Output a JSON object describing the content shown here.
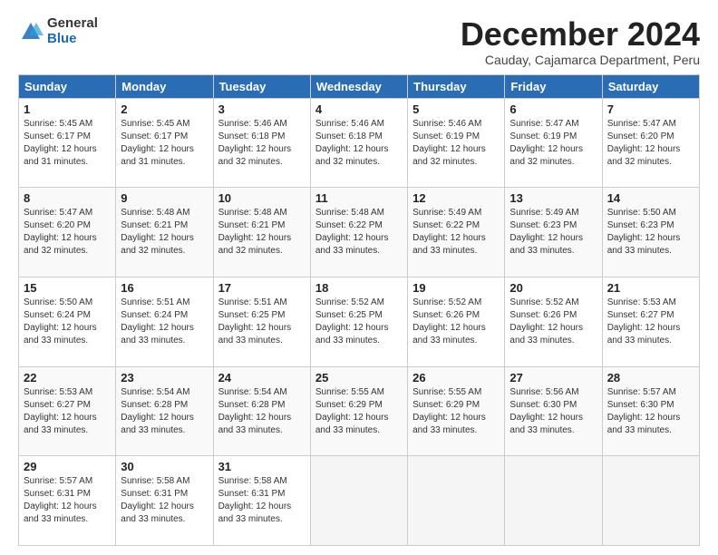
{
  "logo": {
    "general": "General",
    "blue": "Blue"
  },
  "title": "December 2024",
  "subtitle": "Cauday, Cajamarca Department, Peru",
  "headers": [
    "Sunday",
    "Monday",
    "Tuesday",
    "Wednesday",
    "Thursday",
    "Friday",
    "Saturday"
  ],
  "weeks": [
    [
      {
        "day": "1",
        "info": "Sunrise: 5:45 AM\nSunset: 6:17 PM\nDaylight: 12 hours\nand 31 minutes."
      },
      {
        "day": "2",
        "info": "Sunrise: 5:45 AM\nSunset: 6:17 PM\nDaylight: 12 hours\nand 31 minutes."
      },
      {
        "day": "3",
        "info": "Sunrise: 5:46 AM\nSunset: 6:18 PM\nDaylight: 12 hours\nand 32 minutes."
      },
      {
        "day": "4",
        "info": "Sunrise: 5:46 AM\nSunset: 6:18 PM\nDaylight: 12 hours\nand 32 minutes."
      },
      {
        "day": "5",
        "info": "Sunrise: 5:46 AM\nSunset: 6:19 PM\nDaylight: 12 hours\nand 32 minutes."
      },
      {
        "day": "6",
        "info": "Sunrise: 5:47 AM\nSunset: 6:19 PM\nDaylight: 12 hours\nand 32 minutes."
      },
      {
        "day": "7",
        "info": "Sunrise: 5:47 AM\nSunset: 6:20 PM\nDaylight: 12 hours\nand 32 minutes."
      }
    ],
    [
      {
        "day": "8",
        "info": "Sunrise: 5:47 AM\nSunset: 6:20 PM\nDaylight: 12 hours\nand 32 minutes."
      },
      {
        "day": "9",
        "info": "Sunrise: 5:48 AM\nSunset: 6:21 PM\nDaylight: 12 hours\nand 32 minutes."
      },
      {
        "day": "10",
        "info": "Sunrise: 5:48 AM\nSunset: 6:21 PM\nDaylight: 12 hours\nand 32 minutes."
      },
      {
        "day": "11",
        "info": "Sunrise: 5:48 AM\nSunset: 6:22 PM\nDaylight: 12 hours\nand 33 minutes."
      },
      {
        "day": "12",
        "info": "Sunrise: 5:49 AM\nSunset: 6:22 PM\nDaylight: 12 hours\nand 33 minutes."
      },
      {
        "day": "13",
        "info": "Sunrise: 5:49 AM\nSunset: 6:23 PM\nDaylight: 12 hours\nand 33 minutes."
      },
      {
        "day": "14",
        "info": "Sunrise: 5:50 AM\nSunset: 6:23 PM\nDaylight: 12 hours\nand 33 minutes."
      }
    ],
    [
      {
        "day": "15",
        "info": "Sunrise: 5:50 AM\nSunset: 6:24 PM\nDaylight: 12 hours\nand 33 minutes."
      },
      {
        "day": "16",
        "info": "Sunrise: 5:51 AM\nSunset: 6:24 PM\nDaylight: 12 hours\nand 33 minutes."
      },
      {
        "day": "17",
        "info": "Sunrise: 5:51 AM\nSunset: 6:25 PM\nDaylight: 12 hours\nand 33 minutes."
      },
      {
        "day": "18",
        "info": "Sunrise: 5:52 AM\nSunset: 6:25 PM\nDaylight: 12 hours\nand 33 minutes."
      },
      {
        "day": "19",
        "info": "Sunrise: 5:52 AM\nSunset: 6:26 PM\nDaylight: 12 hours\nand 33 minutes."
      },
      {
        "day": "20",
        "info": "Sunrise: 5:52 AM\nSunset: 6:26 PM\nDaylight: 12 hours\nand 33 minutes."
      },
      {
        "day": "21",
        "info": "Sunrise: 5:53 AM\nSunset: 6:27 PM\nDaylight: 12 hours\nand 33 minutes."
      }
    ],
    [
      {
        "day": "22",
        "info": "Sunrise: 5:53 AM\nSunset: 6:27 PM\nDaylight: 12 hours\nand 33 minutes."
      },
      {
        "day": "23",
        "info": "Sunrise: 5:54 AM\nSunset: 6:28 PM\nDaylight: 12 hours\nand 33 minutes."
      },
      {
        "day": "24",
        "info": "Sunrise: 5:54 AM\nSunset: 6:28 PM\nDaylight: 12 hours\nand 33 minutes."
      },
      {
        "day": "25",
        "info": "Sunrise: 5:55 AM\nSunset: 6:29 PM\nDaylight: 12 hours\nand 33 minutes."
      },
      {
        "day": "26",
        "info": "Sunrise: 5:55 AM\nSunset: 6:29 PM\nDaylight: 12 hours\nand 33 minutes."
      },
      {
        "day": "27",
        "info": "Sunrise: 5:56 AM\nSunset: 6:30 PM\nDaylight: 12 hours\nand 33 minutes."
      },
      {
        "day": "28",
        "info": "Sunrise: 5:57 AM\nSunset: 6:30 PM\nDaylight: 12 hours\nand 33 minutes."
      }
    ],
    [
      {
        "day": "29",
        "info": "Sunrise: 5:57 AM\nSunset: 6:31 PM\nDaylight: 12 hours\nand 33 minutes."
      },
      {
        "day": "30",
        "info": "Sunrise: 5:58 AM\nSunset: 6:31 PM\nDaylight: 12 hours\nand 33 minutes."
      },
      {
        "day": "31",
        "info": "Sunrise: 5:58 AM\nSunset: 6:31 PM\nDaylight: 12 hours\nand 33 minutes."
      },
      null,
      null,
      null,
      null
    ]
  ]
}
